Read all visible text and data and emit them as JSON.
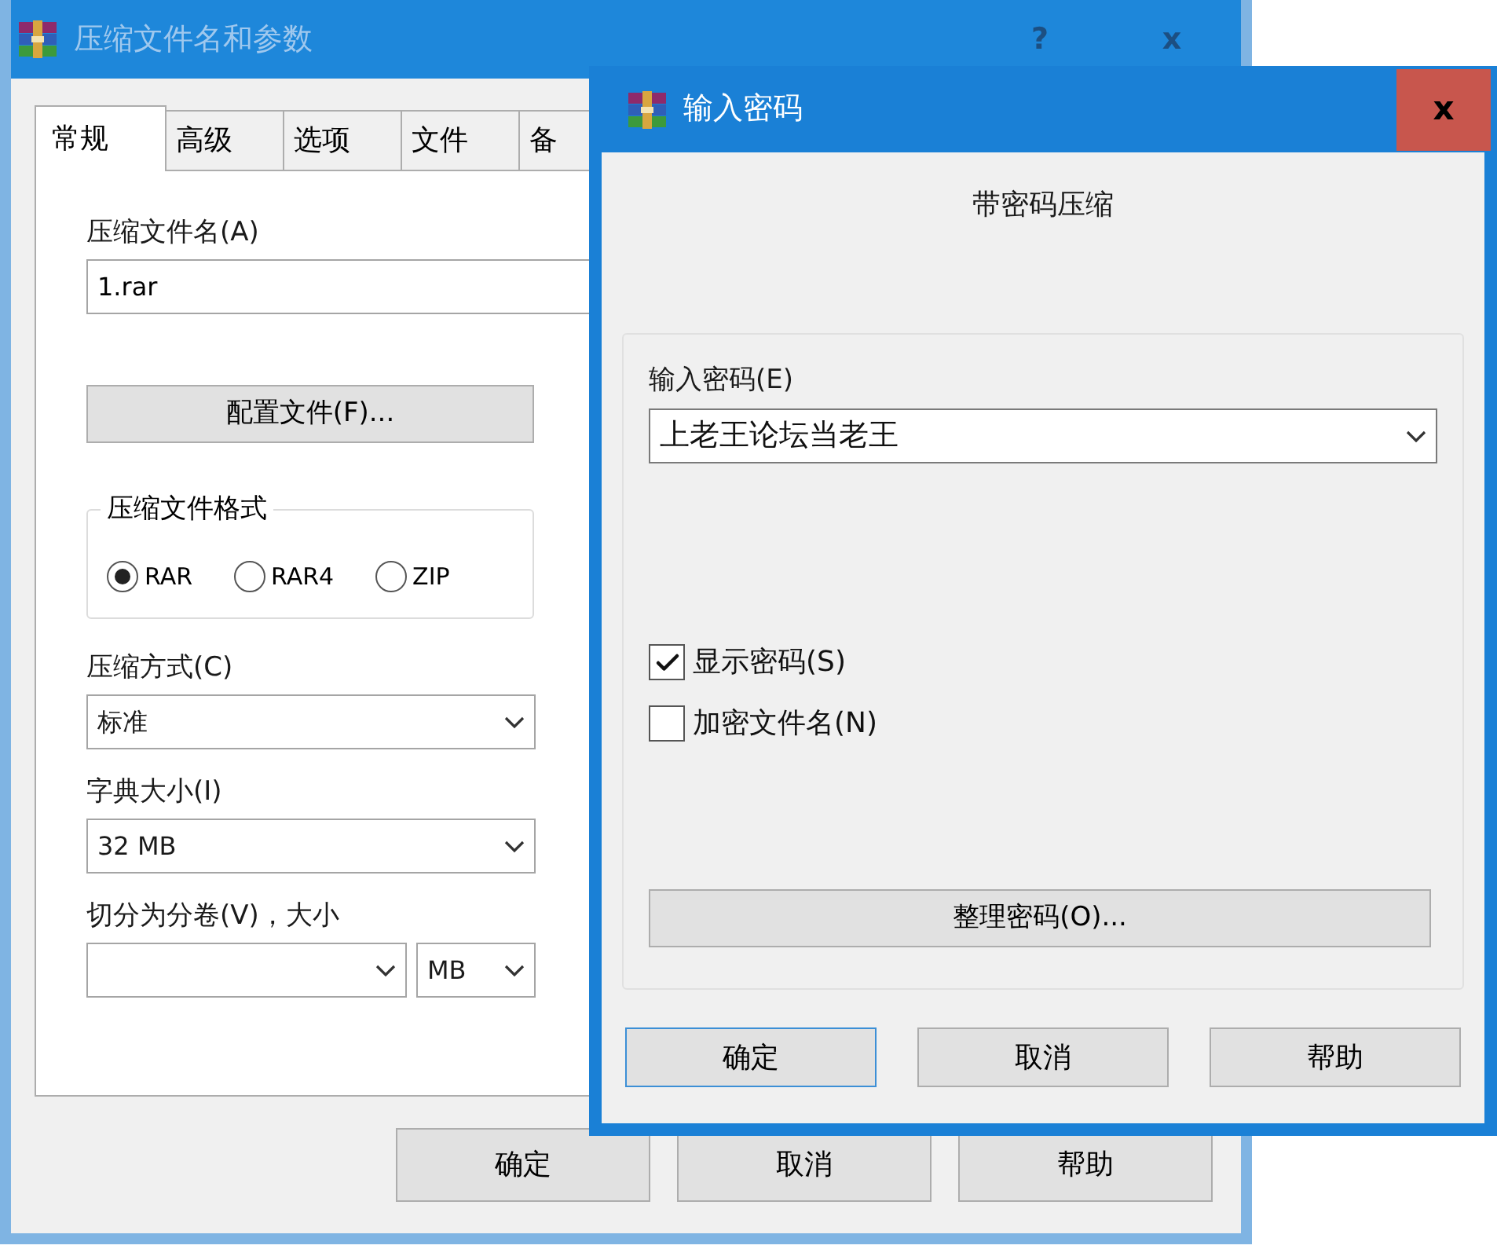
{
  "main_window": {
    "title": "压缩文件名和参数",
    "title_buttons": [
      "?",
      "x"
    ],
    "tabs": [
      {
        "label": "常规",
        "selected": true
      },
      {
        "label": "高级",
        "selected": false
      },
      {
        "label": "选项",
        "selected": false
      },
      {
        "label": "文件",
        "selected": false
      },
      {
        "label": "备",
        "selected": false
      }
    ],
    "archive_name": {
      "label": "压缩文件名(A)",
      "value": "1.rar"
    },
    "profiles_button": "配置文件(F)...",
    "format_group": {
      "title": "压缩文件格式",
      "options": [
        {
          "label": "RAR",
          "selected": true
        },
        {
          "label": "RAR4",
          "selected": false
        },
        {
          "label": "ZIP",
          "selected": false
        }
      ]
    },
    "method": {
      "label": "压缩方式(C)",
      "value": "标准"
    },
    "dictionary": {
      "label": "字典大小(I)",
      "value": "32 MB"
    },
    "split": {
      "label": "切分为分卷(V)，大小",
      "unit": "MB"
    },
    "buttons": [
      "确定",
      "取消",
      "帮助"
    ]
  },
  "password_dialog": {
    "title": "输入密码",
    "close": "x",
    "heading": "带密码压缩",
    "password": {
      "label": "输入密码(E)",
      "value": "上老王论坛当老王"
    },
    "options": [
      {
        "label": "显示密码(S)",
        "checked": true
      },
      {
        "label": "加密文件名(N)",
        "checked": false
      }
    ],
    "organize_button": "整理密码(O)...",
    "buttons": [
      {
        "label": "确定",
        "default": true
      },
      {
        "label": "取消",
        "default": false
      },
      {
        "label": "帮助",
        "default": false
      }
    ]
  }
}
